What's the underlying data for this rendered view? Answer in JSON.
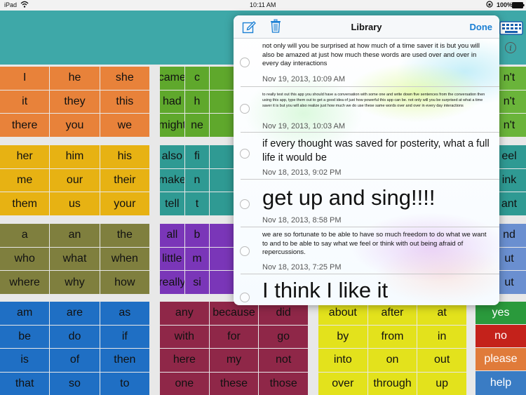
{
  "status": {
    "device": "iPad",
    "time": "10:11 AM"
  },
  "library": {
    "title": "Library",
    "done_label": "Done",
    "entries": [
      {
        "text": "not only will you be surprised at how much of a time saver it is but you will also be amazed at just how much these words are used over and over in every day interactions",
        "date": "Nov 19, 2013, 10:09 AM"
      },
      {
        "text": "to really test out this app you should have a conversation with some one and write down five sentences from the conversation then using this app, type them out to get a good idea of just how powerful this app can be. not only will you be surprised at what a time saver it is but you will also realize just how much we do use these same words over and over in every day interactions",
        "date": "Nov 19, 2013, 10:03 AM"
      },
      {
        "text": "if every thought was saved for posterity, what a full life it would be",
        "date": "Nov 18, 2013, 9:02 PM"
      },
      {
        "text": "get up and sing!!!!",
        "date": "Nov 18, 2013, 8:58 PM"
      },
      {
        "text": "we are so fortunate to be able to have so much freedom to do what we want to and to be able to say what we feel or think with out being afraid of repercussions.",
        "date": "Nov 18, 2013, 7:25 PM"
      },
      {
        "text": "I think I like it",
        "date": ""
      }
    ]
  },
  "word_grid": {
    "blocks": [
      {
        "color": "#e8823a",
        "words": [
          "I",
          "he",
          "she",
          "it",
          "they",
          "this",
          "there",
          "you",
          "we"
        ]
      },
      {
        "color": "#5fa82c",
        "words": [
          "came",
          "c",
          "",
          "had",
          "h",
          "",
          "might",
          "ne",
          ""
        ]
      },
      {
        "color": "#e7b213",
        "words": [
          "her",
          "him",
          "his",
          "me",
          "our",
          "their",
          "them",
          "us",
          "your"
        ]
      },
      {
        "color": "#2f9a93",
        "words": [
          "also",
          "fi",
          "",
          "make",
          "n",
          "",
          "tell",
          "t",
          ""
        ]
      },
      {
        "color": "#7f7f3e",
        "words": [
          "a",
          "an",
          "the",
          "who",
          "what",
          "when",
          "where",
          "why",
          "how"
        ]
      },
      {
        "color": "#7a36b8",
        "words": [
          "all",
          "b",
          "",
          "little",
          "m",
          "",
          "really",
          "si",
          ""
        ]
      },
      {
        "color": "#1f6fc4",
        "words": [
          "am",
          "are",
          "as",
          "be",
          "do",
          "if",
          "is",
          "of",
          "then",
          "that",
          "so",
          "to"
        ]
      },
      {
        "color": "#8f2748",
        "words": [
          "any",
          "because",
          "did",
          "with",
          "for",
          "go",
          "here",
          "my",
          "not",
          "one",
          "these",
          "those"
        ]
      },
      {
        "color": "#e3e21c",
        "words": [
          "about",
          "after",
          "at",
          "by",
          "from",
          "in",
          "into",
          "on",
          "out",
          "over",
          "through",
          "up"
        ]
      },
      {
        "color": "#6ab43a",
        "words": [
          "n't",
          "n't",
          "n't"
        ]
      },
      {
        "color": "#2f9a93",
        "words": [
          "eel",
          "ink",
          "ant"
        ]
      },
      {
        "color": "#6a8fd0",
        "words": [
          "nd",
          "ut",
          "ut"
        ]
      },
      {
        "color": "#2a9a3c",
        "words": [
          "yes"
        ]
      },
      {
        "color": "#c4221b",
        "words": [
          "no"
        ]
      },
      {
        "color": "#e07b3a",
        "words": [
          "please"
        ]
      },
      {
        "color": "#3a7cc4",
        "words": [
          "help"
        ]
      }
    ]
  }
}
